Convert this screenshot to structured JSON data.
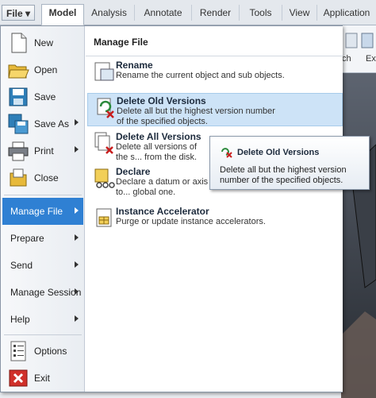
{
  "ribbon": {
    "tabs": [
      {
        "label": "File ▾"
      },
      {
        "label": "Model"
      },
      {
        "label": "Analysis"
      },
      {
        "label": "Annotate"
      },
      {
        "label": "Render"
      },
      {
        "label": "Tools"
      },
      {
        "label": "View"
      },
      {
        "label": "Application"
      }
    ],
    "partial_labels": [
      "ch",
      "Ex"
    ]
  },
  "file_menu": {
    "items": [
      {
        "label": "New",
        "icon": "new-document-icon"
      },
      {
        "label": "Open",
        "icon": "open-folder-icon"
      },
      {
        "label": "Save",
        "icon": "save-disk-icon"
      },
      {
        "label": "Save As",
        "icon": "save-as-icon"
      },
      {
        "label": "Print",
        "icon": "printer-icon"
      },
      {
        "label": "Close",
        "icon": "close-document-icon"
      }
    ],
    "submenus": [
      {
        "label": "Manage File",
        "selected": true
      },
      {
        "label": "Prepare"
      },
      {
        "label": "Send"
      },
      {
        "label": "Manage Session"
      },
      {
        "label": "Help"
      }
    ],
    "bottom": [
      {
        "label": "Options",
        "icon": "options-icon"
      },
      {
        "label": "Exit",
        "icon": "exit-icon"
      }
    ]
  },
  "manage_file": {
    "title": "Manage File",
    "items": [
      {
        "title": "Rename",
        "desc": "Rename the current object and sub objects."
      },
      {
        "title": "Delete Old Versions",
        "desc": "Delete all but the highest version number of the specified objects."
      },
      {
        "title": "Delete All Versions",
        "desc": "Delete all versions of the s... from the disk."
      },
      {
        "title": "Declare",
        "desc": "Declare a datum or axis to... global one."
      },
      {
        "title": "Instance Accelerator",
        "desc": "Purge or update instance accelerators."
      }
    ]
  },
  "tooltip": {
    "title": "Delete Old Versions",
    "desc": "Delete all but the highest version number of the specified objects."
  }
}
